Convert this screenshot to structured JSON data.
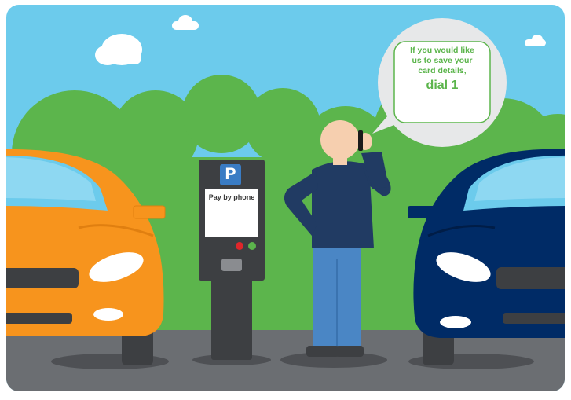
{
  "speech_bubble": {
    "line1": "If you would like",
    "line2": "us to save your",
    "line3": "card details,",
    "emphasis": "dial 1"
  },
  "parking_meter": {
    "sign_letter": "P",
    "screen_label": "Pay by phone",
    "lights": [
      "red",
      "green"
    ]
  },
  "colors": {
    "sky": "#6ccbec",
    "bushes": "#5cb54c",
    "road": "#6b6e72",
    "car_left": "#f7941d",
    "car_right": "#002b66",
    "meter": "#3d3f42",
    "p_sign": "#3a7cc4",
    "shirt": "#213b63",
    "jeans": "#4a86c5",
    "skin": "#f6cfaf",
    "accent_text": "#5cb54c"
  },
  "icons": [
    "cloud-icon",
    "parking-sign-icon",
    "phone-icon"
  ]
}
